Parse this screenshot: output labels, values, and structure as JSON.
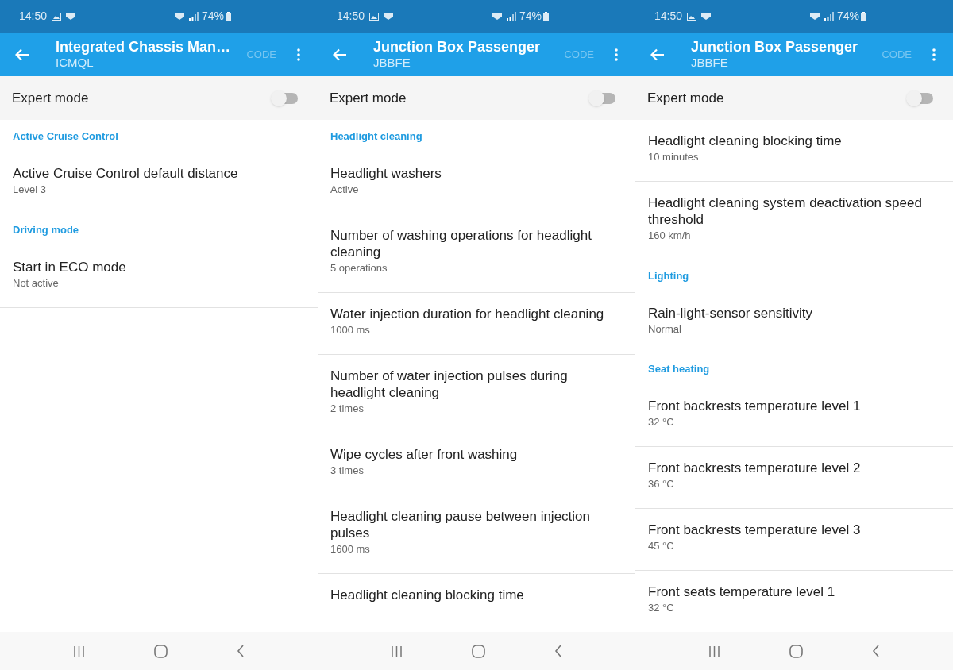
{
  "screens": [
    {
      "status_bar": {
        "time": "14:50",
        "battery": "74%"
      },
      "app_bar": {
        "title": "Integrated Chassis Man…",
        "subtitle": "ICMQL",
        "action": {
          "label": "CODE",
          "disabled": true
        }
      },
      "expert_mode": {
        "label": "Expert mode",
        "on": false
      },
      "items": [
        {
          "kind": "section",
          "title": "Active Cruise Control"
        },
        {
          "kind": "setting",
          "title": "Active Cruise Control default distance",
          "value": "Level 3",
          "divider": false
        },
        {
          "kind": "section",
          "title": "Driving mode"
        },
        {
          "kind": "setting",
          "title": "Start in ECO mode",
          "value": "Not active",
          "divider": true
        }
      ]
    },
    {
      "status_bar": {
        "time": "14:50",
        "battery": "74%"
      },
      "app_bar": {
        "title": "Junction Box Passenger",
        "subtitle": "JBBFE",
        "action": {
          "label": "CODE",
          "disabled": true
        }
      },
      "expert_mode": {
        "label": "Expert mode",
        "on": false
      },
      "items": [
        {
          "kind": "section",
          "title": "Headlight cleaning"
        },
        {
          "kind": "setting",
          "title": "Headlight washers",
          "value": "Active",
          "divider": true
        },
        {
          "kind": "setting",
          "title": "Number of washing operations for headlight cleaning",
          "value": "5 operations",
          "divider": true
        },
        {
          "kind": "setting",
          "title": "Water injection duration for headlight cleaning",
          "value": "1000 ms",
          "divider": true
        },
        {
          "kind": "setting",
          "title": "Number of water injection pulses during headlight cleaning",
          "value": "2 times",
          "divider": true
        },
        {
          "kind": "setting",
          "title": "Wipe cycles after front washing",
          "value": "3 times",
          "divider": true
        },
        {
          "kind": "setting",
          "title": "Headlight cleaning pause between injection pulses",
          "value": "1600 ms",
          "divider": true
        },
        {
          "kind": "setting",
          "title": "Headlight cleaning blocking time",
          "divider": false
        }
      ]
    },
    {
      "status_bar": {
        "time": "14:50",
        "battery": "74%"
      },
      "app_bar": {
        "title": "Junction Box Passenger",
        "subtitle": "JBBFE",
        "action": {
          "label": "CODE",
          "disabled": true
        }
      },
      "expert_mode": {
        "label": "Expert mode",
        "on": false
      },
      "items": [
        {
          "kind": "setting",
          "title": "Headlight cleaning blocking time",
          "value": "10 minutes",
          "divider": true
        },
        {
          "kind": "setting",
          "title": "Headlight cleaning system deactivation speed threshold",
          "value": "160 km/h",
          "divider": false
        },
        {
          "kind": "section",
          "title": "Lighting"
        },
        {
          "kind": "setting",
          "title": "Rain-light-sensor sensitivity",
          "value": "Normal",
          "divider": false
        },
        {
          "kind": "section",
          "title": "Seat heating"
        },
        {
          "kind": "setting",
          "title": "Front backrests temperature level 1",
          "value": "32 °C",
          "divider": true
        },
        {
          "kind": "setting",
          "title": "Front backrests temperature level 2",
          "value": "36 °C",
          "divider": true
        },
        {
          "kind": "setting",
          "title": "Front backrests temperature level 3",
          "value": "45 °C",
          "divider": true
        },
        {
          "kind": "setting",
          "title": "Front seats temperature level 1",
          "value": "32 °C",
          "divider": false
        }
      ]
    }
  ]
}
